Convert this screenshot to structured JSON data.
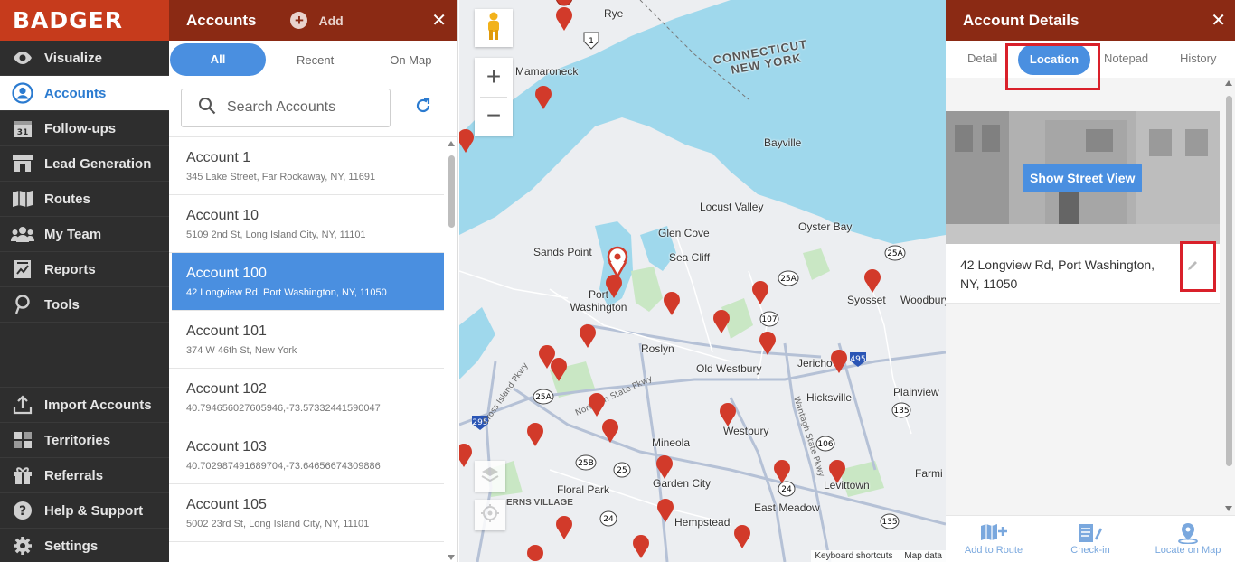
{
  "brand": "BADGER",
  "nav": {
    "items": [
      {
        "label": "Visualize",
        "icon": "eye-icon"
      },
      {
        "label": "Accounts",
        "icon": "user-circle-icon",
        "active": true
      },
      {
        "label": "Follow-ups",
        "icon": "calendar-icon",
        "badge": "31"
      },
      {
        "label": "Lead Generation",
        "icon": "storefront-icon"
      },
      {
        "label": "Routes",
        "icon": "folded-map-icon"
      },
      {
        "label": "My Team",
        "icon": "team-icon"
      },
      {
        "label": "Reports",
        "icon": "chart-report-icon"
      },
      {
        "label": "Tools",
        "icon": "map-pin-tool-icon"
      }
    ],
    "bottom_items": [
      {
        "label": "Import Accounts",
        "icon": "upload-icon"
      },
      {
        "label": "Territories",
        "icon": "territories-icon"
      },
      {
        "label": "Referrals",
        "icon": "gift-icon"
      },
      {
        "label": "Help & Support",
        "icon": "help-icon"
      },
      {
        "label": "Settings",
        "icon": "gear-icon"
      }
    ]
  },
  "accounts_panel": {
    "title": "Accounts",
    "add_label": "Add",
    "filters": [
      "All",
      "Recent",
      "On Map"
    ],
    "active_filter": "All",
    "search_placeholder": "Search Accounts",
    "rows": [
      {
        "name": "Account 1",
        "address": "345 Lake Street, Far Rockaway, NY, 11691"
      },
      {
        "name": "Account 10",
        "address": "5109 2nd St, Long Island City, NY, 11101"
      },
      {
        "name": "Account 100",
        "address": "42 Longview Rd, Port Washington, NY, 11050",
        "selected": true
      },
      {
        "name": "Account 101",
        "address": "374 W 46th St, New York"
      },
      {
        "name": "Account 102",
        "address": "40.794656027605946,-73.57332441590047"
      },
      {
        "name": "Account 103",
        "address": "40.702987491689704,-73.64656674309886"
      },
      {
        "name": "Account 105",
        "address": "5002 23rd St, Long Island City, NY, 11101"
      }
    ]
  },
  "map": {
    "place_labels": [
      "Rye",
      "Mamaroneck",
      "CONNECTICUT",
      "NEW YORK",
      "Bayville",
      "Locust Valley",
      "Glen Cove",
      "Oyster Bay",
      "Sands Point",
      "Sea Cliff",
      "Port Washington",
      "Syosset",
      "Woodbury",
      "Roslyn",
      "Old Westbury",
      "Jericho",
      "Hicksville",
      "Plainview",
      "Westbury",
      "Mineola",
      "Garden City",
      "Floral Park",
      "Levittown",
      "Hempstead",
      "East Meadow",
      "ERNS VILLAGE",
      "Farmi"
    ],
    "route_shields": [
      "1",
      "25A",
      "25A",
      "107",
      "106",
      "25A",
      "25",
      "25B",
      "24",
      "135",
      "106",
      "24",
      "135",
      "495",
      "295"
    ],
    "road_labels": [
      "Cross Island Pkwy",
      "Northern State Pkwy",
      "Wantagh State Pkwy"
    ],
    "footer": [
      "Keyboard shortcuts",
      "Map data"
    ]
  },
  "details": {
    "title": "Account Details",
    "tabs": [
      "Detail",
      "Location",
      "Notepad",
      "History"
    ],
    "active_tab": "Location",
    "street_view_button": "Show Street View",
    "address_line1": "42 Longview Rd, Port Washington,",
    "address_line2": "NY, 11050",
    "footer_actions": [
      {
        "label": "Add to Route",
        "icon": "add-to-route-icon"
      },
      {
        "label": "Check-in",
        "icon": "check-in-icon"
      },
      {
        "label": "Locate on Map",
        "icon": "locate-on-map-icon"
      }
    ]
  },
  "colors": {
    "brand_red": "#c63b1c",
    "header_dark_red": "#8b2a14",
    "accent_blue": "#4a8fe0",
    "highlight_red": "#d9202a",
    "nav_bg": "#2e2e2e"
  }
}
